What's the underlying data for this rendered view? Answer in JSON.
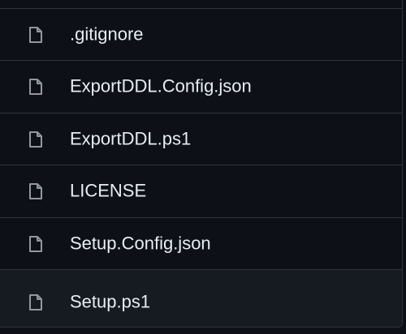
{
  "files": [
    {
      "name": ".gitignore",
      "icon": "file-icon"
    },
    {
      "name": "ExportDDL.Config.json",
      "icon": "file-icon"
    },
    {
      "name": "ExportDDL.ps1",
      "icon": "file-icon"
    },
    {
      "name": "LICENSE",
      "icon": "file-icon"
    },
    {
      "name": "Setup.Config.json",
      "icon": "file-icon"
    },
    {
      "name": "Setup.ps1",
      "icon": "file-icon"
    }
  ],
  "colors": {
    "background": "#0d1117",
    "row_hover": "#161b22",
    "border": "#30363d",
    "text": "#e6edf3",
    "icon": "#9198a1"
  }
}
